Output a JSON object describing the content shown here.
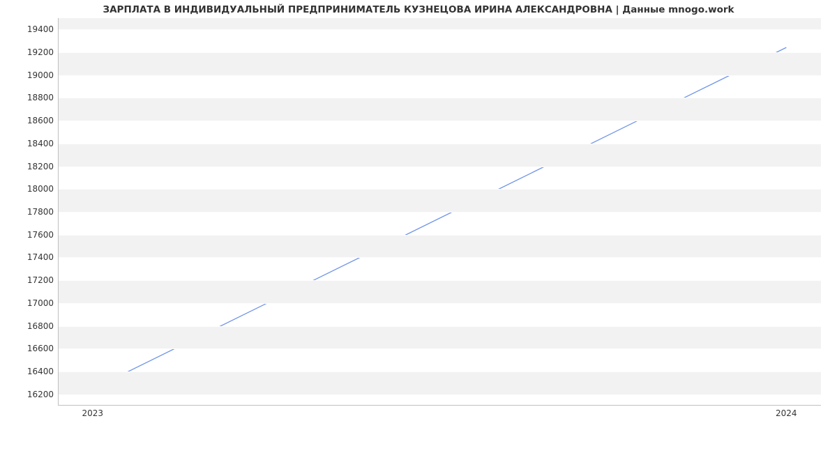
{
  "chart_data": {
    "type": "line",
    "title": "ЗАРПЛАТА В ИНДИВИДУАЛЬНЫЙ ПРЕДПРИНИМАТЕЛЬ КУЗНЕЦОВА ИРИНА АЛЕКСАНДРОВНА | Данные mnogo.work",
    "x": [
      2023,
      2024
    ],
    "values": [
      16242,
      19242
    ],
    "x_ticks": [
      2023,
      2024
    ],
    "y_ticks": [
      16200,
      16400,
      16600,
      16800,
      17000,
      17200,
      17400,
      17600,
      17800,
      18000,
      18200,
      18400,
      18600,
      18800,
      19000,
      19200,
      19400
    ],
    "ylim": [
      16100,
      19500
    ],
    "xlim": [
      2022.95,
      2024.05
    ],
    "xlabel": "",
    "ylabel": ""
  }
}
